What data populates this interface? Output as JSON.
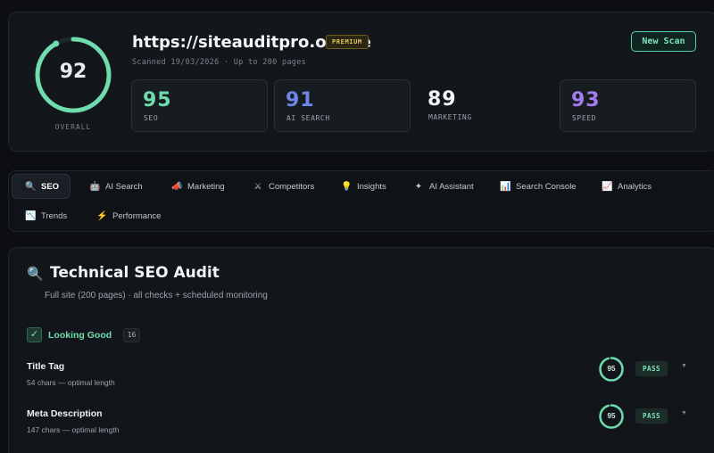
{
  "header": {
    "overall": {
      "value": "92",
      "label": "OVERALL",
      "percent": 92
    },
    "url": "https://siteauditpro.online",
    "plan_badge": "PREMIUM",
    "scan_meta": "Scanned 19/03/2026 · Up to 200 pages",
    "new_scan_label": "New Scan",
    "scores": [
      {
        "value": "95",
        "label": "SEO",
        "color": "#6fdcae"
      },
      {
        "value": "91",
        "label": "AI SEARCH",
        "color": "#6f86e8"
      },
      {
        "value": "89",
        "label": "MARKETING",
        "color": "#f2f3f5"
      },
      {
        "value": "93",
        "label": "SPEED",
        "color": "#a47bf0"
      }
    ]
  },
  "tabs": [
    {
      "label": "SEO",
      "icon": "magnifier-icon",
      "glyph": "🔍",
      "active": true
    },
    {
      "label": "AI Search",
      "icon": "robot-icon",
      "glyph": "🤖"
    },
    {
      "label": "Marketing",
      "icon": "megaphone-icon",
      "glyph": "📣"
    },
    {
      "label": "Competitors",
      "icon": "swords-icon",
      "glyph": "⚔"
    },
    {
      "label": "Insights",
      "icon": "lightbulb-icon",
      "glyph": "💡"
    },
    {
      "label": "AI Assistant",
      "icon": "sparkle-icon",
      "glyph": "✦"
    },
    {
      "label": "Search Console",
      "icon": "bar-chart-icon",
      "glyph": "📊"
    },
    {
      "label": "Analytics",
      "icon": "trend-up-icon",
      "glyph": "📈"
    },
    {
      "label": "Trends",
      "icon": "trend-down-icon",
      "glyph": "📉"
    },
    {
      "label": "Performance",
      "icon": "lightning-icon",
      "glyph": "⚡"
    }
  ],
  "audit": {
    "icon": "magnifier-icon",
    "title": "Technical SEO Audit",
    "subtitle": "Full site (200 pages) · all checks + scheduled monitoring",
    "group": {
      "label": "Looking Good",
      "count": "16"
    },
    "checks": [
      {
        "title": "Title Tag",
        "detail": "54 chars — optimal length",
        "score": "95",
        "percent": 95,
        "status": "PASS"
      },
      {
        "title": "Meta Description",
        "detail": "147 chars — optimal length",
        "score": "95",
        "percent": 95,
        "status": "PASS"
      }
    ]
  },
  "colors": {
    "accent": "#6fdcae",
    "background": "#0c0e11",
    "card": "#13161b"
  }
}
